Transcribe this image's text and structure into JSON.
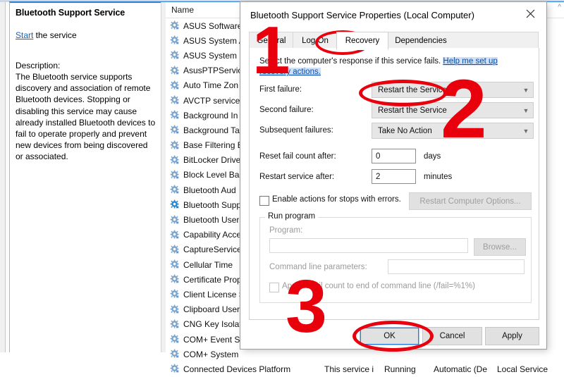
{
  "details_pane": {
    "service_title": "Bluetooth Support Service",
    "start_link": "Start",
    "start_suffix": " the service",
    "description_label": "Description:",
    "description_text": "The Bluetooth service supports discovery and association of remote Bluetooth devices.  Stopping or disabling this service may cause already installed Bluetooth devices to fail to operate properly and prevent new devices from being discovered or associated."
  },
  "list_pane": {
    "column_header_name": "Name",
    "scroll_up_glyph": "^",
    "rows": [
      {
        "label": "ASUS Software",
        "selected": false
      },
      {
        "label": "ASUS System A",
        "selected": false
      },
      {
        "label": "ASUS System D",
        "selected": false
      },
      {
        "label": "AsusPTPService",
        "selected": false
      },
      {
        "label": "Auto Time Zon",
        "selected": false
      },
      {
        "label": "AVCTP service",
        "selected": false
      },
      {
        "label": "Background In",
        "selected": false
      },
      {
        "label": "Background Ta",
        "selected": false
      },
      {
        "label": "Base Filtering E",
        "selected": false
      },
      {
        "label": "BitLocker Drive",
        "selected": false
      },
      {
        "label": "Block Level Bac",
        "selected": false
      },
      {
        "label": "Bluetooth Aud",
        "selected": false
      },
      {
        "label": "Bluetooth Supp",
        "selected": true
      },
      {
        "label": "Bluetooth User",
        "selected": false
      },
      {
        "label": "Capability Acce",
        "selected": false
      },
      {
        "label": "CaptureService",
        "selected": false
      },
      {
        "label": "Cellular Time",
        "selected": false
      },
      {
        "label": "Certificate Prop",
        "selected": false
      },
      {
        "label": "Client License S",
        "selected": false
      },
      {
        "label": "Clipboard User",
        "selected": false
      },
      {
        "label": "CNG Key Isolat",
        "selected": false
      },
      {
        "label": "COM+ Event S",
        "selected": false
      },
      {
        "label": "COM+ System",
        "selected": false
      },
      {
        "label": "Connected Devices Platform",
        "selected": false
      }
    ],
    "last_row_extra": {
      "description": "This service i",
      "status": "Running",
      "startup_type": "Automatic (De",
      "log_on_as": "Local Service"
    }
  },
  "dialog": {
    "title": "Bluetooth Support Service Properties (Local Computer)",
    "close_icon": "close-icon",
    "tabs": [
      {
        "label": "General",
        "active": false
      },
      {
        "label": "Log On",
        "active": false
      },
      {
        "label": "Recovery",
        "active": true
      },
      {
        "label": "Dependencies",
        "active": false
      }
    ],
    "recovery": {
      "intro_text": "Select the computer's response if this service fails. ",
      "help_link": "Help me set up recovery actions.",
      "first_failure_label": "First failure:",
      "first_failure_value": "Restart the Service",
      "second_failure_label": "Second failure:",
      "second_failure_value": "Restart the Service",
      "subsequent_failures_label": "Subsequent failures:",
      "subsequent_failures_value": "Take No Action",
      "reset_fail_count_label": "Reset fail count after:",
      "reset_fail_count_value": "0",
      "reset_fail_count_unit": "days",
      "restart_service_label": "Restart service after:",
      "restart_service_value": "2",
      "restart_service_unit": "minutes",
      "enable_actions_label": "Enable actions for stops with errors.",
      "enable_actions_checked": false,
      "restart_computer_options_button": "Restart Computer Options...",
      "run_program_legend": "Run program",
      "program_label": "Program:",
      "program_value": "",
      "browse_button": "Browse...",
      "command_line_label": "Command line parameters:",
      "command_line_value": "",
      "append_fail_count_label": "Append fail count to end of command line (/fail=%1%)",
      "append_fail_count_checked": false
    },
    "buttons": {
      "ok": "OK",
      "cancel": "Cancel",
      "apply": "Apply"
    }
  },
  "annotations": {
    "accent_color": "#e8000d",
    "step1": "1",
    "step2": "2",
    "step3": "3",
    "circled_items": [
      "Recovery tab",
      "First failure dropdown",
      "OK button"
    ]
  }
}
